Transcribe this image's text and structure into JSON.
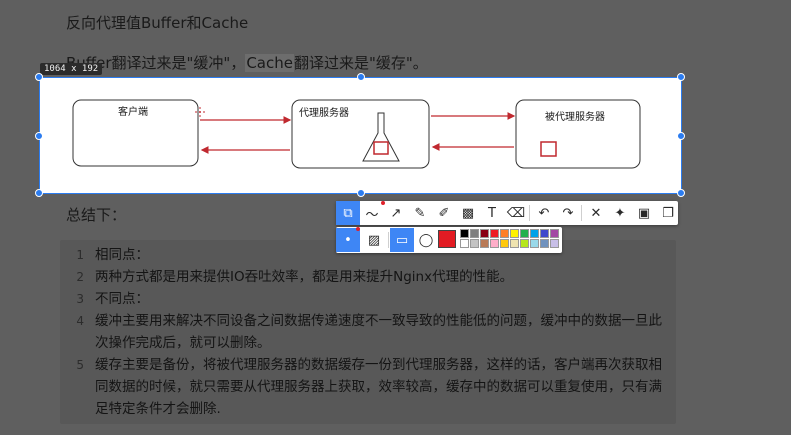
{
  "doc": {
    "heading": "反向代理值Buffer和Cache",
    "line_pre": "Buffer翻译过来是\"缓冲\"，",
    "line_hl": "Cache",
    "line_post": "翻译过来是\"缓存\"。",
    "summary_title": "总结下："
  },
  "capture": {
    "size_label": "1064 x 192"
  },
  "diagram": {
    "client_label": "客户端",
    "proxy_label": "代理服务器",
    "backend_label": "被代理服务器",
    "arrow_color": "#c0292f"
  },
  "list": [
    {
      "num": "1",
      "text": "相同点："
    },
    {
      "num": "2",
      "text": "两种方式都是用来提供IO吞吐效率，都是用来提升Nginx代理的性能。"
    },
    {
      "num": "3",
      "text": "不同点："
    },
    {
      "num": "4",
      "text": "缓冲主要用来解决不同设备之间数据传递速度不一致导致的性能低的问题，缓冲中的数据一旦此次操作完成后，就可以删除。"
    },
    {
      "num": "5",
      "text": "缓存主要是备份，将被代理服务器的数据缓存一份到代理服务器，这样的话，客户端再次获取相同数据的时候，就只需要从代理服务器上获取，效率较高，缓存中的数据可以重复使用，只有满足特定条件才会删除."
    }
  ],
  "toolbar": {
    "tools_row1": [
      {
        "icon": "select-shape-icon",
        "glyph": "⧉"
      },
      {
        "icon": "freehand-line-icon",
        "glyph": "〜"
      },
      {
        "icon": "arrow-icon",
        "glyph": "↗"
      },
      {
        "icon": "pen-icon",
        "glyph": "✎"
      },
      {
        "icon": "marker-icon",
        "glyph": "✐"
      },
      {
        "icon": "mosaic-icon",
        "glyph": "▩"
      },
      {
        "icon": "text-icon",
        "glyph": "T"
      },
      {
        "icon": "eraser-icon",
        "glyph": "⌫"
      },
      {
        "icon": "undo-icon",
        "glyph": "↶"
      },
      {
        "icon": "redo-icon",
        "glyph": "↷"
      },
      {
        "icon": "close-icon",
        "glyph": "✕"
      },
      {
        "icon": "pin-icon",
        "glyph": "✦"
      },
      {
        "icon": "save-icon",
        "glyph": "▣"
      },
      {
        "icon": "copy-icon",
        "glyph": "❐"
      }
    ],
    "selected_color": "#e21b23",
    "palette": [
      "#000000",
      "#7f7f7f",
      "#880015",
      "#ed1c24",
      "#ff7f27",
      "#fff200",
      "#22b14c",
      "#00a2e8",
      "#3f48cc",
      "#a349a4",
      "#ffffff",
      "#c3c3c3",
      "#b97a57",
      "#ffaec9",
      "#ffc90e",
      "#efe4b0",
      "#b5e61d",
      "#99d9ea",
      "#7092be",
      "#c8bfe7"
    ]
  }
}
